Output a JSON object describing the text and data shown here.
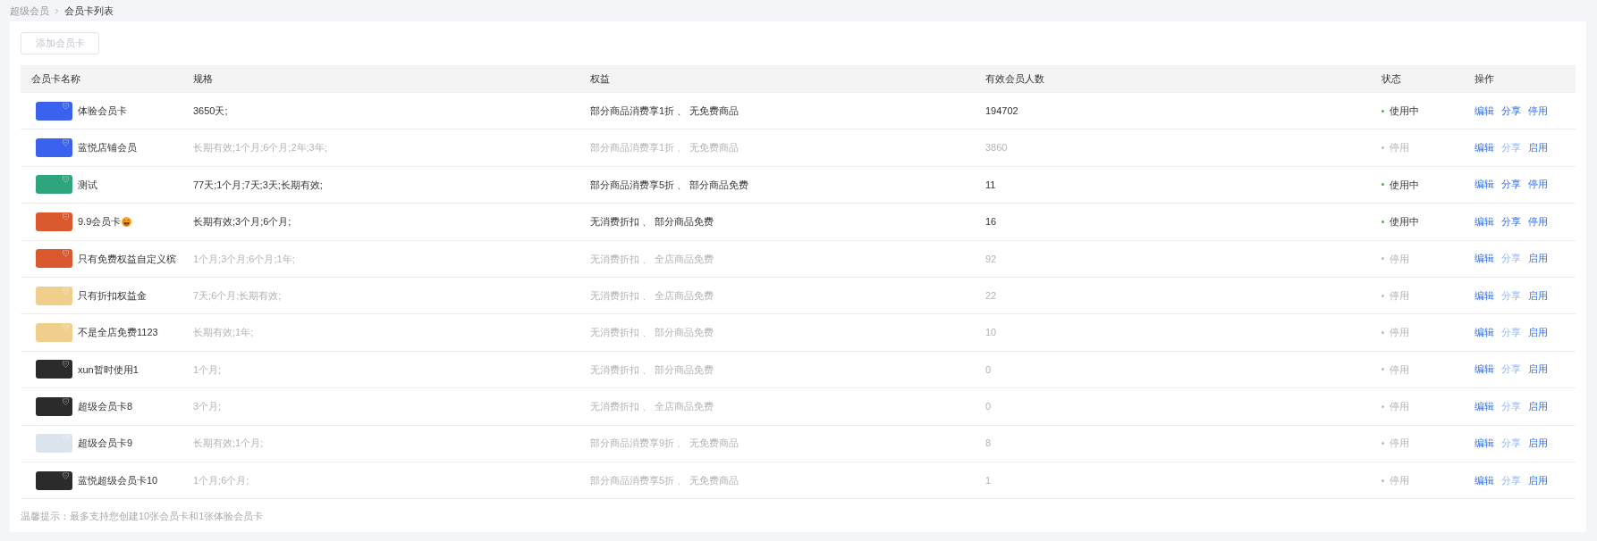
{
  "breadcrumb": [
    {
      "label": "超级会员",
      "current": false
    },
    {
      "label": "会员卡列表",
      "current": true
    }
  ],
  "add_button": {
    "label": "添加会员卡",
    "disabled": true
  },
  "table": {
    "columns": [
      "会员卡名称",
      "规格",
      "权益",
      "有效会员人数",
      "状态",
      "操作"
    ],
    "rows": [
      {
        "color": "#3b62ee",
        "name": "体验会员卡",
        "emoji": false,
        "spec": "3650天;",
        "benefits": "部分商品消费享1折 、 无免费商品",
        "members": "194702",
        "enabled": true,
        "status": "使用中",
        "actions": [
          {
            "label": "编辑",
            "disabled": false
          },
          {
            "label": "分享",
            "disabled": false
          },
          {
            "label": "停用",
            "disabled": false
          }
        ]
      },
      {
        "color": "#3b62ee",
        "name": "蓝悦店铺会员",
        "emoji": false,
        "spec": "长期有效;1个月;6个月;2年;3年;",
        "benefits": "部分商品消费享1折 、 无免费商品",
        "members": "3860",
        "enabled": false,
        "status": "停用",
        "actions": [
          {
            "label": "编辑",
            "disabled": false
          },
          {
            "label": "分享",
            "disabled": true
          },
          {
            "label": "启用",
            "disabled": false
          }
        ]
      },
      {
        "color": "#2ea57e",
        "name": "测试",
        "emoji": false,
        "spec": "77天;1个月;7天;3天;长期有效;",
        "benefits": "部分商品消费享5折 、 部分商品免费",
        "members": "11",
        "enabled": true,
        "status": "使用中",
        "actions": [
          {
            "label": "编辑",
            "disabled": false
          },
          {
            "label": "分享",
            "disabled": false
          },
          {
            "label": "停用",
            "disabled": false
          }
        ]
      },
      {
        "color": "#d9582e",
        "name": "9.9会员卡",
        "emoji": true,
        "spec": "长期有效;3个月;6个月;",
        "benefits": "无消费折扣 、 部分商品免费",
        "members": "16",
        "enabled": true,
        "status": "使用中",
        "actions": [
          {
            "label": "编辑",
            "disabled": false
          },
          {
            "label": "分享",
            "disabled": false
          },
          {
            "label": "停用",
            "disabled": false
          }
        ]
      },
      {
        "color": "#d9582e",
        "name": "只有免费权益自定义槟",
        "emoji": false,
        "spec": "1个月;3个月;6个月;1年;",
        "benefits": "无消费折扣 、 全店商品免费",
        "members": "92",
        "enabled": false,
        "status": "停用",
        "actions": [
          {
            "label": "编辑",
            "disabled": false
          },
          {
            "label": "分享",
            "disabled": true
          },
          {
            "label": "启用",
            "disabled": false
          }
        ]
      },
      {
        "color": "#f0cf8c",
        "name": "只有折扣权益金",
        "emoji": false,
        "spec": "7天;6个月;长期有效;",
        "benefits": "无消费折扣 、 全店商品免费",
        "members": "22",
        "enabled": false,
        "status": "停用",
        "actions": [
          {
            "label": "编辑",
            "disabled": false
          },
          {
            "label": "分享",
            "disabled": true
          },
          {
            "label": "启用",
            "disabled": false
          }
        ]
      },
      {
        "color": "#f0cf8c",
        "name": "不是全店免费1123",
        "emoji": false,
        "spec": "长期有效;1年;",
        "benefits": "无消费折扣 、 部分商品免费",
        "members": "10",
        "enabled": false,
        "status": "停用",
        "actions": [
          {
            "label": "编辑",
            "disabled": false
          },
          {
            "label": "分享",
            "disabled": true
          },
          {
            "label": "启用",
            "disabled": false
          }
        ]
      },
      {
        "color": "#2b2b2b",
        "name": "xun暂时使用1",
        "emoji": false,
        "spec": "1个月;",
        "benefits": "无消费折扣 、 部分商品免费",
        "members": "0",
        "enabled": false,
        "status": "停用",
        "actions": [
          {
            "label": "编辑",
            "disabled": false
          },
          {
            "label": "分享",
            "disabled": true
          },
          {
            "label": "启用",
            "disabled": false
          }
        ]
      },
      {
        "color": "#2b2b2b",
        "name": "超级会员卡8",
        "emoji": false,
        "spec": "3个月;",
        "benefits": "无消费折扣 、 全店商品免费",
        "members": "0",
        "enabled": false,
        "status": "停用",
        "actions": [
          {
            "label": "编辑",
            "disabled": false
          },
          {
            "label": "分享",
            "disabled": true
          },
          {
            "label": "启用",
            "disabled": false
          }
        ]
      },
      {
        "color": "#dbe3ec",
        "name": "超级会员卡9",
        "emoji": false,
        "spec": "长期有效;1个月;",
        "benefits": "部分商品消费享9折 、 无免费商品",
        "members": "8",
        "enabled": false,
        "status": "停用",
        "actions": [
          {
            "label": "编辑",
            "disabled": false
          },
          {
            "label": "分享",
            "disabled": true
          },
          {
            "label": "启用",
            "disabled": false
          }
        ]
      },
      {
        "color": "#2b2b2b",
        "name": "蓝悦超级会员卡10",
        "emoji": false,
        "spec": "1个月;6个月;",
        "benefits": "部分商品消费享5折 、 无免费商品",
        "members": "1",
        "enabled": false,
        "status": "停用",
        "actions": [
          {
            "label": "编辑",
            "disabled": false
          },
          {
            "label": "分享",
            "disabled": true
          },
          {
            "label": "启用",
            "disabled": false
          }
        ]
      }
    ]
  },
  "footer_note": "温馨提示：最多支持您创建10张会员卡和1张体验会员卡"
}
